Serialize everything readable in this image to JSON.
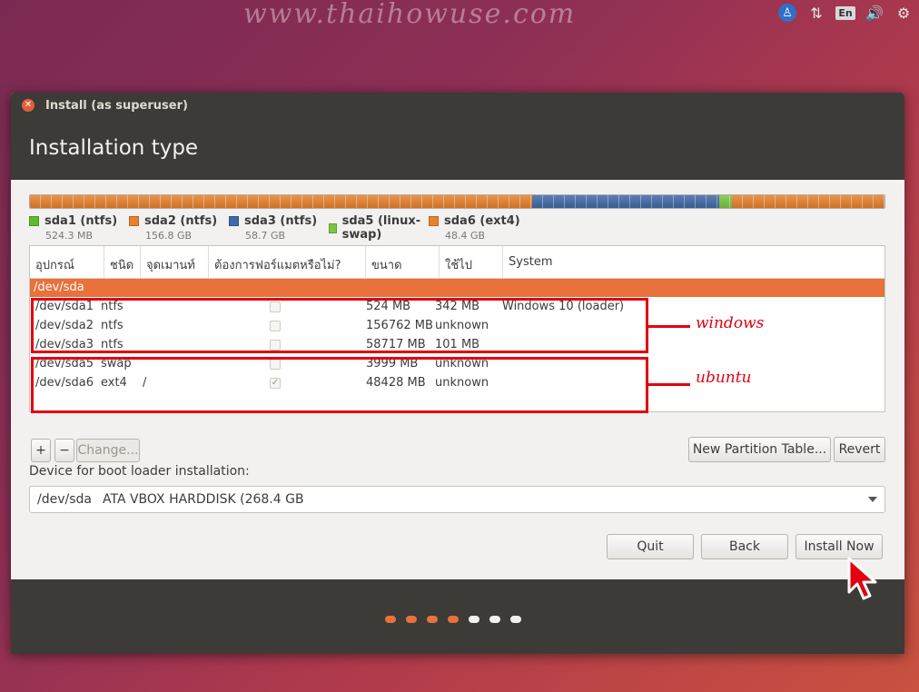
{
  "watermark": "www.thaihowuse.com",
  "tray": {
    "accessibility_icon": "accessibility-icon",
    "network_icon": "network-arrows-icon",
    "language": "En",
    "volume_icon": "volume-icon",
    "settings_icon": "gear-icon"
  },
  "window": {
    "title": "Install (as superuser)",
    "heading": "Installation type"
  },
  "legend": [
    {
      "name": "sda1 (ntfs)",
      "size": "524.3 MB",
      "color": "#5dbb2e"
    },
    {
      "name": "sda2 (ntfs)",
      "size": "156.8 GB",
      "color": "#e8812c"
    },
    {
      "name": "sda3 (ntfs)",
      "size": "58.7 GB",
      "color": "#3f69a8"
    },
    {
      "name": "sda5 (linux-swap)",
      "size": "4.0 GB",
      "color": "#7ac643"
    },
    {
      "name": "sda6 (ext4)",
      "size": "48.4 GB",
      "color": "#e8812c"
    }
  ],
  "bar_colors": {
    "ntfs": "#e8812c",
    "ntfs_blue": "#3f69a8",
    "swap": "#7ac643",
    "ext4": "#e8812c"
  },
  "table": {
    "headers": [
      "อุปกรณ์",
      "ชนิด",
      "จุดเมานท์",
      "ต้องการฟอร์แมตหรือไม่?",
      "ขนาด",
      "ใช้ไป",
      "System"
    ],
    "device": "/dev/sda",
    "rows": [
      {
        "device": "/dev/sda1",
        "type": "ntfs",
        "mount": "",
        "format": false,
        "size": "524 MB",
        "used": "342 MB",
        "system": "Windows 10 (loader)"
      },
      {
        "device": "/dev/sda2",
        "type": "ntfs",
        "mount": "",
        "format": false,
        "size": "156762 MB",
        "used": "unknown",
        "system": ""
      },
      {
        "device": "/dev/sda3",
        "type": "ntfs",
        "mount": "",
        "format": false,
        "size": "58717 MB",
        "used": "101 MB",
        "system": ""
      },
      {
        "device": "/dev/sda5",
        "type": "swap",
        "mount": "",
        "format": false,
        "size": "3999 MB",
        "used": "unknown",
        "system": ""
      },
      {
        "device": "/dev/sda6",
        "type": "ext4",
        "mount": "/",
        "format": true,
        "size": "48428 MB",
        "used": "unknown",
        "system": ""
      }
    ]
  },
  "annotations": {
    "windows": "windows",
    "ubuntu": "ubuntu",
    "color": "#e3000f"
  },
  "buttons": {
    "add": "+",
    "remove": "−",
    "change": "Change...",
    "new_table": "New Partition Table...",
    "revert": "Revert",
    "quit": "Quit",
    "back": "Back",
    "install": "Install Now"
  },
  "boot": {
    "label": "Device for boot loader installation:",
    "device": "/dev/sda",
    "description": "ATA VBOX HARDDISK (268.4 GB"
  },
  "progress": {
    "total": 7,
    "completed": 4,
    "active_color": "#e8713c",
    "inactive_color": "#f2f1f0"
  }
}
